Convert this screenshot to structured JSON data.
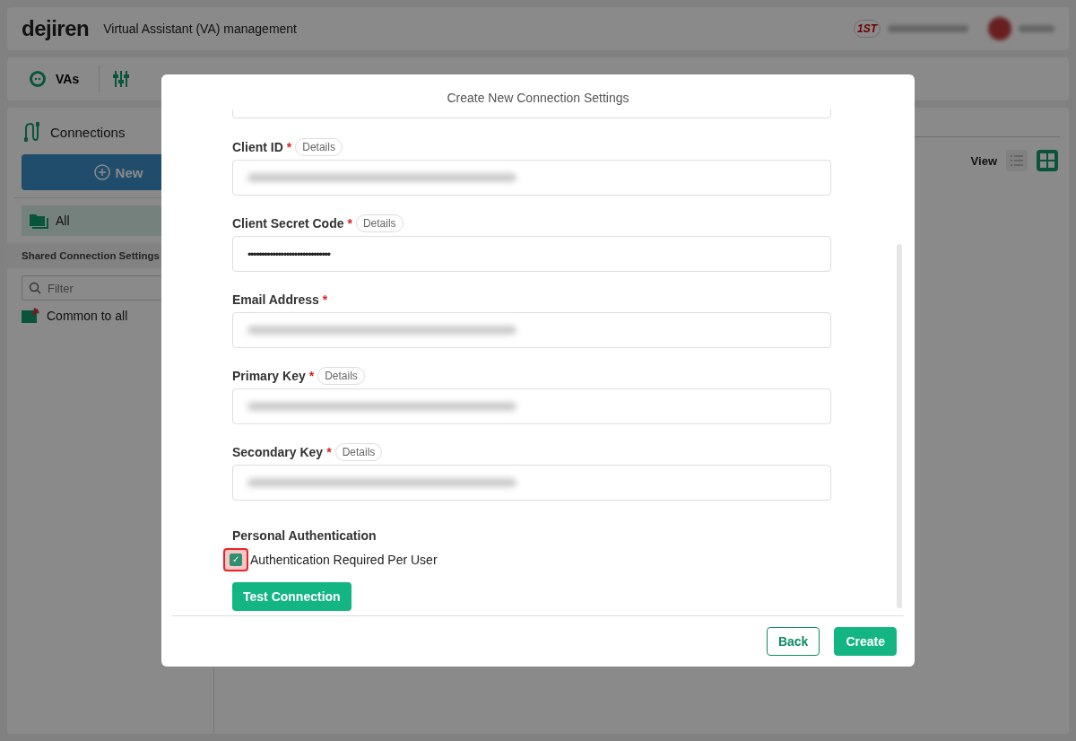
{
  "header": {
    "logo": "dejiren",
    "title": "Virtual Assistant (VA) management",
    "badge": "1ST"
  },
  "nav": {
    "tabs": [
      {
        "label": "VAs",
        "selected": true
      }
    ]
  },
  "sidebar": {
    "title": "Connections",
    "new_button": "New",
    "items": [
      {
        "label": "All",
        "selected": true
      }
    ],
    "section": "Shared Connection Settings",
    "filter": {
      "placeholder": "Filter"
    },
    "shared_items": [
      {
        "label": "Common to all"
      }
    ]
  },
  "main": {
    "view_label": "View",
    "views": [
      {
        "kind": "list",
        "selected": false
      },
      {
        "kind": "grid",
        "selected": true
      }
    ]
  },
  "dialog": {
    "title": "Create New Connection Settings",
    "fields": [
      {
        "label": "Client ID",
        "required": "*",
        "details": "Details",
        "redacted": true
      },
      {
        "label": "Client Secret Code",
        "required": "*",
        "details": "Details",
        "value": "••••••••••••••••••••••••••••••"
      },
      {
        "label": "Email Address",
        "required": "*",
        "redacted": true
      },
      {
        "label": "Primary Key",
        "required": "*",
        "details": "Details",
        "redacted": true
      },
      {
        "label": "Secondary Key",
        "required": "*",
        "details": "Details",
        "redacted": true
      }
    ],
    "section": "Personal Authentication",
    "checkbox": {
      "label": "Authentication Required Per User",
      "checked": true,
      "tick": "✓",
      "highlighted": true
    },
    "test_button": "Test Connection",
    "buttons": [
      {
        "label": "Back",
        "kind": "secondary"
      },
      {
        "label": "Create",
        "kind": "primary"
      }
    ]
  }
}
